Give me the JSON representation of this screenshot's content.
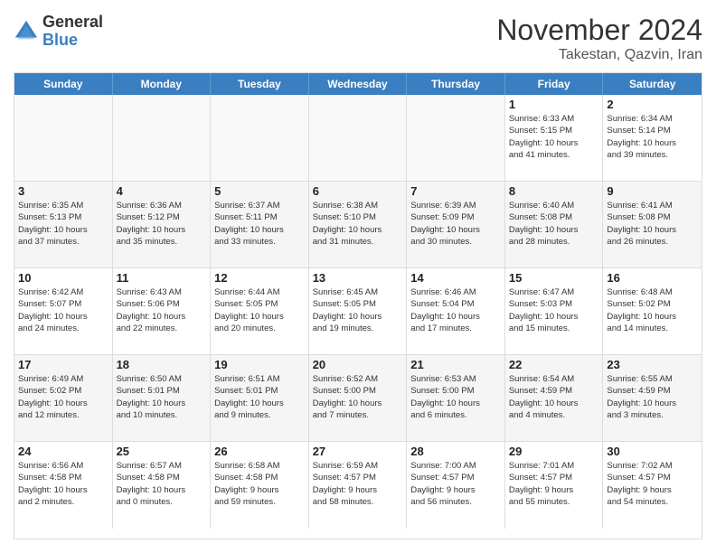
{
  "logo": {
    "general": "General",
    "blue": "Blue"
  },
  "title": "November 2024",
  "location": "Takestan, Qazvin, Iran",
  "days_header": [
    "Sunday",
    "Monday",
    "Tuesday",
    "Wednesday",
    "Thursday",
    "Friday",
    "Saturday"
  ],
  "weeks": [
    [
      {
        "day": "",
        "info": ""
      },
      {
        "day": "",
        "info": ""
      },
      {
        "day": "",
        "info": ""
      },
      {
        "day": "",
        "info": ""
      },
      {
        "day": "",
        "info": ""
      },
      {
        "day": "1",
        "info": "Sunrise: 6:33 AM\nSunset: 5:15 PM\nDaylight: 10 hours\nand 41 minutes."
      },
      {
        "day": "2",
        "info": "Sunrise: 6:34 AM\nSunset: 5:14 PM\nDaylight: 10 hours\nand 39 minutes."
      }
    ],
    [
      {
        "day": "3",
        "info": "Sunrise: 6:35 AM\nSunset: 5:13 PM\nDaylight: 10 hours\nand 37 minutes."
      },
      {
        "day": "4",
        "info": "Sunrise: 6:36 AM\nSunset: 5:12 PM\nDaylight: 10 hours\nand 35 minutes."
      },
      {
        "day": "5",
        "info": "Sunrise: 6:37 AM\nSunset: 5:11 PM\nDaylight: 10 hours\nand 33 minutes."
      },
      {
        "day": "6",
        "info": "Sunrise: 6:38 AM\nSunset: 5:10 PM\nDaylight: 10 hours\nand 31 minutes."
      },
      {
        "day": "7",
        "info": "Sunrise: 6:39 AM\nSunset: 5:09 PM\nDaylight: 10 hours\nand 30 minutes."
      },
      {
        "day": "8",
        "info": "Sunrise: 6:40 AM\nSunset: 5:08 PM\nDaylight: 10 hours\nand 28 minutes."
      },
      {
        "day": "9",
        "info": "Sunrise: 6:41 AM\nSunset: 5:08 PM\nDaylight: 10 hours\nand 26 minutes."
      }
    ],
    [
      {
        "day": "10",
        "info": "Sunrise: 6:42 AM\nSunset: 5:07 PM\nDaylight: 10 hours\nand 24 minutes."
      },
      {
        "day": "11",
        "info": "Sunrise: 6:43 AM\nSunset: 5:06 PM\nDaylight: 10 hours\nand 22 minutes."
      },
      {
        "day": "12",
        "info": "Sunrise: 6:44 AM\nSunset: 5:05 PM\nDaylight: 10 hours\nand 20 minutes."
      },
      {
        "day": "13",
        "info": "Sunrise: 6:45 AM\nSunset: 5:05 PM\nDaylight: 10 hours\nand 19 minutes."
      },
      {
        "day": "14",
        "info": "Sunrise: 6:46 AM\nSunset: 5:04 PM\nDaylight: 10 hours\nand 17 minutes."
      },
      {
        "day": "15",
        "info": "Sunrise: 6:47 AM\nSunset: 5:03 PM\nDaylight: 10 hours\nand 15 minutes."
      },
      {
        "day": "16",
        "info": "Sunrise: 6:48 AM\nSunset: 5:02 PM\nDaylight: 10 hours\nand 14 minutes."
      }
    ],
    [
      {
        "day": "17",
        "info": "Sunrise: 6:49 AM\nSunset: 5:02 PM\nDaylight: 10 hours\nand 12 minutes."
      },
      {
        "day": "18",
        "info": "Sunrise: 6:50 AM\nSunset: 5:01 PM\nDaylight: 10 hours\nand 10 minutes."
      },
      {
        "day": "19",
        "info": "Sunrise: 6:51 AM\nSunset: 5:01 PM\nDaylight: 10 hours\nand 9 minutes."
      },
      {
        "day": "20",
        "info": "Sunrise: 6:52 AM\nSunset: 5:00 PM\nDaylight: 10 hours\nand 7 minutes."
      },
      {
        "day": "21",
        "info": "Sunrise: 6:53 AM\nSunset: 5:00 PM\nDaylight: 10 hours\nand 6 minutes."
      },
      {
        "day": "22",
        "info": "Sunrise: 6:54 AM\nSunset: 4:59 PM\nDaylight: 10 hours\nand 4 minutes."
      },
      {
        "day": "23",
        "info": "Sunrise: 6:55 AM\nSunset: 4:59 PM\nDaylight: 10 hours\nand 3 minutes."
      }
    ],
    [
      {
        "day": "24",
        "info": "Sunrise: 6:56 AM\nSunset: 4:58 PM\nDaylight: 10 hours\nand 2 minutes."
      },
      {
        "day": "25",
        "info": "Sunrise: 6:57 AM\nSunset: 4:58 PM\nDaylight: 10 hours\nand 0 minutes."
      },
      {
        "day": "26",
        "info": "Sunrise: 6:58 AM\nSunset: 4:58 PM\nDaylight: 9 hours\nand 59 minutes."
      },
      {
        "day": "27",
        "info": "Sunrise: 6:59 AM\nSunset: 4:57 PM\nDaylight: 9 hours\nand 58 minutes."
      },
      {
        "day": "28",
        "info": "Sunrise: 7:00 AM\nSunset: 4:57 PM\nDaylight: 9 hours\nand 56 minutes."
      },
      {
        "day": "29",
        "info": "Sunrise: 7:01 AM\nSunset: 4:57 PM\nDaylight: 9 hours\nand 55 minutes."
      },
      {
        "day": "30",
        "info": "Sunrise: 7:02 AM\nSunset: 4:57 PM\nDaylight: 9 hours\nand 54 minutes."
      }
    ]
  ]
}
